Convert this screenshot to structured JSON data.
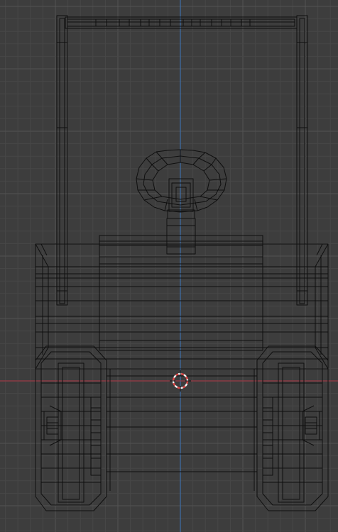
{
  "viewport": {
    "view": "front",
    "shading": "wireframe",
    "theme": {
      "background": "#3d3d3d",
      "grid_minor": "#474747",
      "grid_major": "#535353",
      "x_axis": "#9b3b45",
      "z_axis": "#3e6fa8",
      "wire": "#0f0f0f",
      "cursor_red": "#e04848",
      "cursor_white": "#f2f2f2"
    },
    "icons": {
      "cursor": "3d-cursor-icon"
    }
  }
}
